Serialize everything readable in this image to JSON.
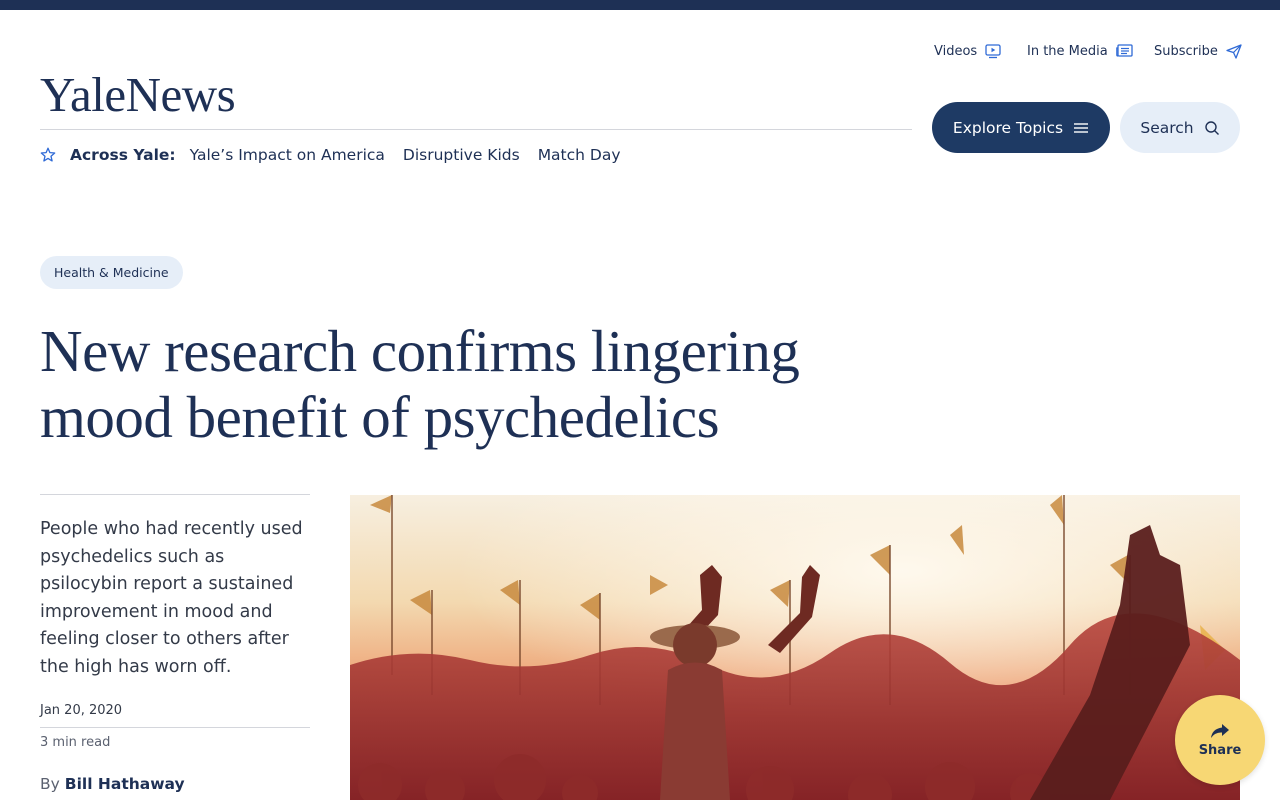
{
  "site": {
    "logo": "YaleNews"
  },
  "utility_nav": {
    "videos": "Videos",
    "in_the_media": "In the Media",
    "subscribe": "Subscribe"
  },
  "header_buttons": {
    "explore": "Explore Topics",
    "search": "Search"
  },
  "across_yale": {
    "label": "Across Yale:",
    "links": [
      "Yale’s Impact on America",
      "Disruptive Kids",
      "Match Day"
    ]
  },
  "article": {
    "category": "Health & Medicine",
    "title": "New research confirms lingering mood benefit of psychedelics",
    "summary": "People who had recently used psychedelics such as psilocybin report a sustained improvement in mood and feeling closer to others after the high has worn off.",
    "date": "Jan 20, 2020",
    "read_time": "3 min read",
    "byline_prefix": "By",
    "author": "Bill Hathaway"
  },
  "share": {
    "label": "Share"
  },
  "colors": {
    "navy": "#1e3055",
    "button_navy": "#1e3a64",
    "pale_blue": "#e6eef8",
    "share_yellow": "#f7d774"
  },
  "icons": {
    "across": "star-icon",
    "videos": "play-icon",
    "media": "newspaper-icon",
    "subscribe": "paper-plane-icon",
    "explore": "menu-icon",
    "search": "search-icon",
    "share": "share-arrow-icon"
  }
}
